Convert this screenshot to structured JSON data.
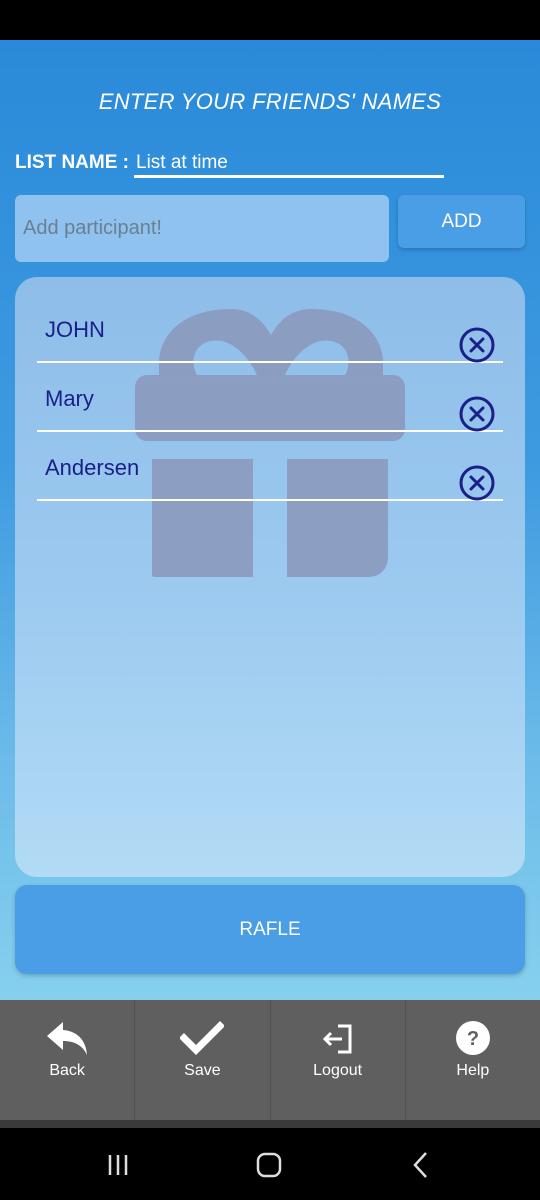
{
  "header": {
    "title": "ENTER YOUR FRIENDS' NAMES"
  },
  "list_name": {
    "label": "LIST NAME :",
    "value": "List at time"
  },
  "add_participant": {
    "placeholder": "Add participant!",
    "button_label": "ADD"
  },
  "participants": [
    {
      "name": "JOHN"
    },
    {
      "name": "Mary"
    },
    {
      "name": "Andersen"
    }
  ],
  "rafle_button": {
    "label": "RAFLE"
  },
  "bottom_nav": [
    {
      "label": "Back",
      "icon": "back-arrow-icon"
    },
    {
      "label": "Save",
      "icon": "checkmark-icon"
    },
    {
      "label": "Logout",
      "icon": "logout-icon"
    },
    {
      "label": "Help",
      "icon": "help-icon"
    }
  ],
  "colors": {
    "primary": "#2a8ad9",
    "button": "#4a9ee5",
    "name_text": "#1a1f8a",
    "nav_bg": "#5f5f5f"
  }
}
